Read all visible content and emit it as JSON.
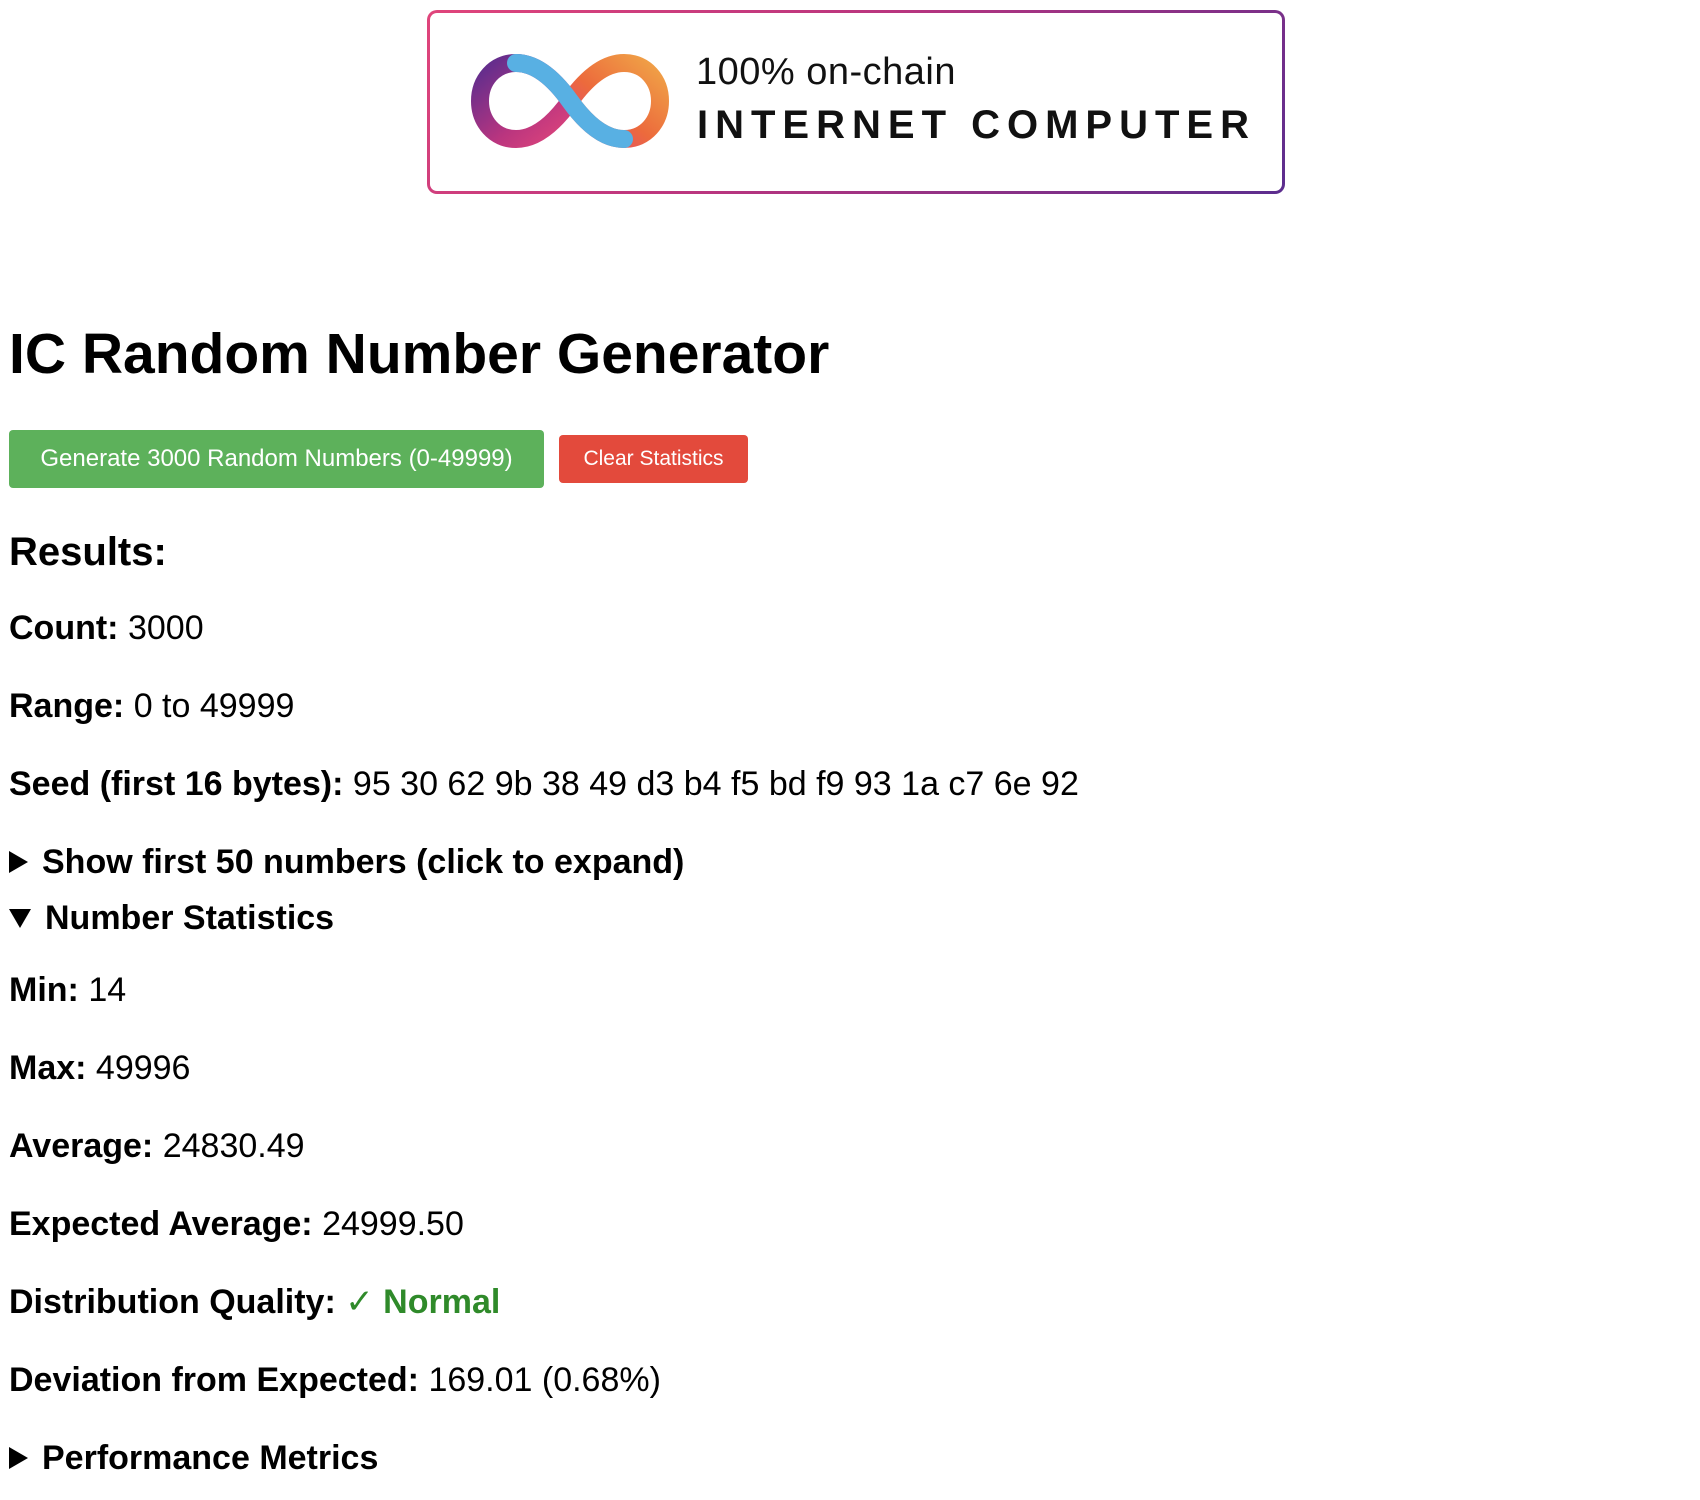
{
  "logo": {
    "tagline": "100% on-chain",
    "name": "INTERNET COMPUTER",
    "colors": {
      "border_start": "#e0457b",
      "border_end": "#5b2d8e",
      "loop_left": [
        "#5b2d8e",
        "#e0457b"
      ],
      "loop_right": [
        "#f0a447",
        "#e0457b"
      ],
      "loop_blue": "#58b0e3"
    }
  },
  "page": {
    "title": "IC Random Number Generator"
  },
  "buttons": {
    "generate_label": "Generate 3000 Random Numbers (0-49999)",
    "clear_label": "Clear Statistics",
    "generate_color": "#5db15b",
    "clear_color": "#e34a3c"
  },
  "results": {
    "heading": "Results:",
    "count": {
      "label": "Count:",
      "value": "3000"
    },
    "range": {
      "label": "Range:",
      "value": "0 to 49999"
    },
    "seed": {
      "label": "Seed (first 16 bytes):",
      "value": "95 30 62 9b 38 49 d3 b4 f5 bd f9 93 1a c7 6e 92"
    },
    "first_numbers_toggle": {
      "label": "Show first 50 numbers (click to expand)",
      "expanded": false
    }
  },
  "statistics": {
    "toggle_label": "Number Statistics",
    "expanded": true,
    "min": {
      "label": "Min:",
      "value": "14"
    },
    "max": {
      "label": "Max:",
      "value": "49996"
    },
    "average": {
      "label": "Average:",
      "value": "24830.49"
    },
    "expected_average": {
      "label": "Expected Average:",
      "value": "24999.50"
    },
    "distribution_quality": {
      "label": "Distribution Quality:",
      "value": "✓ Normal",
      "color": "#2f8a2a"
    },
    "deviation": {
      "label": "Deviation from Expected:",
      "value": "169.01 (0.68%)"
    }
  },
  "performance": {
    "toggle_label": "Performance Metrics",
    "expanded": false
  }
}
